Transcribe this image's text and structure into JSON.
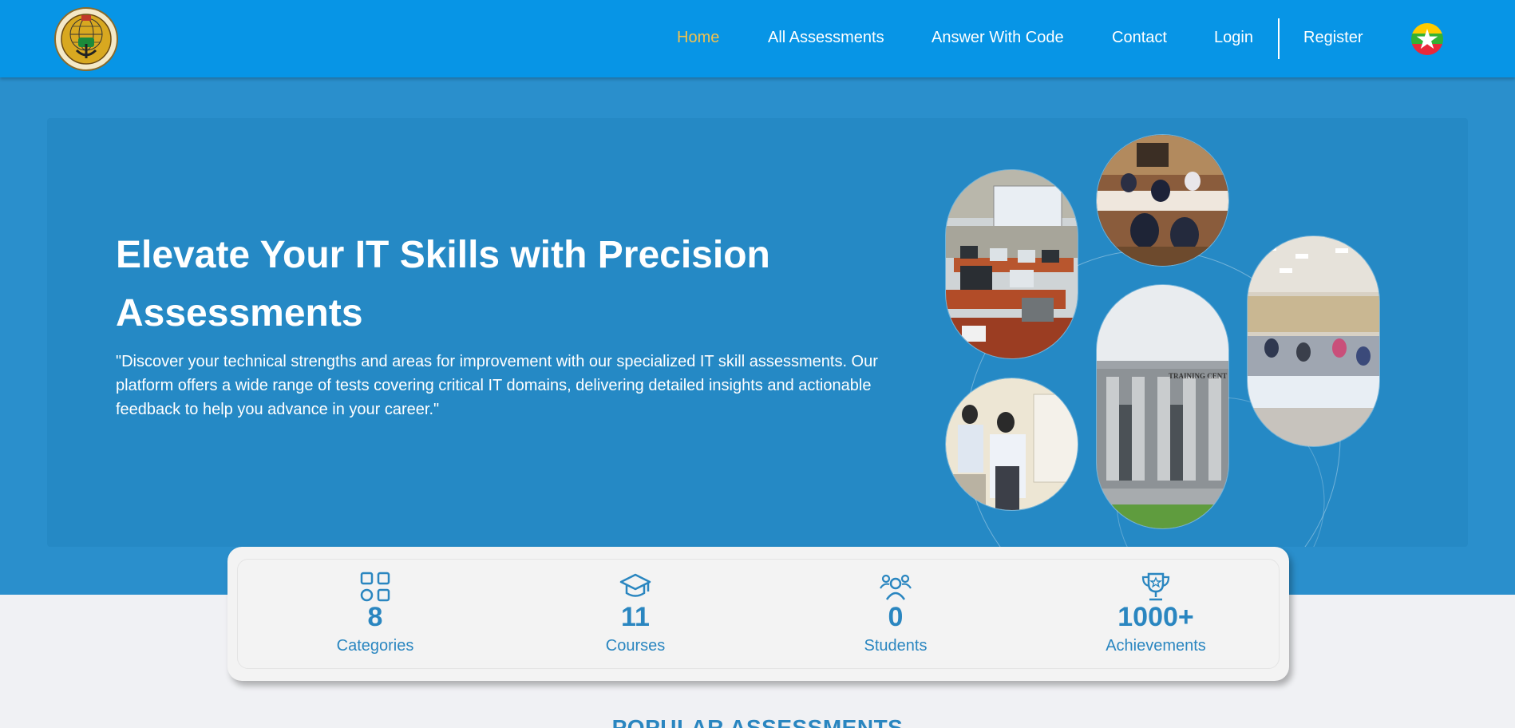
{
  "nav": {
    "items": [
      {
        "label": "Home",
        "active": true
      },
      {
        "label": "All Assessments",
        "active": false
      },
      {
        "label": "Answer With Code",
        "active": false
      },
      {
        "label": "Contact",
        "active": false
      },
      {
        "label": "Login",
        "active": false
      },
      {
        "label": "Register",
        "active": false
      }
    ],
    "logo_icon": "emblem-logo",
    "language_icon": "myanmar-flag-icon",
    "active_color": "#f2c14e"
  },
  "hero": {
    "title": "Elevate Your IT Skills with Precision Assessments",
    "description": "\"Discover your technical strengths and areas for improvement with our specialized IT skill assessments. Our platform offers a wide range of tests covering critical IT domains, delivering detailed insights and actionable feedback to help you advance in your career.\"",
    "building_sign": "TRAINING CENT"
  },
  "stats": [
    {
      "icon": "categories-icon",
      "value": "8",
      "label": "Categories"
    },
    {
      "icon": "graduation-cap-icon",
      "value": "11",
      "label": "Courses"
    },
    {
      "icon": "students-icon",
      "value": "0",
      "label": "Students"
    },
    {
      "icon": "trophy-icon",
      "value": "1000+",
      "label": "Achievements"
    }
  ],
  "section": {
    "popular_heading": "POPULAR ASSESSMENTS"
  },
  "colors": {
    "navbar": "#0795e6",
    "hero": "#2a8fcc",
    "accent": "#2a86c0"
  }
}
